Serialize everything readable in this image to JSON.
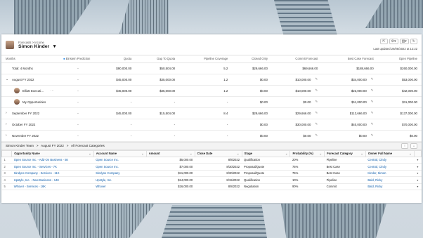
{
  "header": {
    "breadcrumb": "Forecasts  >  Income",
    "user_name": "Simon Kinder",
    "last_updated": "Last updated 26/08/2022 at 12:22",
    "tool_icons": [
      "share-icon",
      "gear-icon",
      "columns-icon",
      "refresh-icon"
    ]
  },
  "forecast": {
    "columns": [
      "Months",
      "Einstein Prediction",
      "Quota",
      "Gap To Quota",
      "Pipeline Coverage",
      "Closed Only",
      "Commit Forecast",
      "Best Case Forecast",
      "Open Pipeline"
    ],
    "rows": [
      {
        "name": "Total: 4 Months",
        "level": 0,
        "chevron": "",
        "einstein": "-",
        "quota": "$90,000.00",
        "gap": "$50,504.00",
        "coverage": "5.2",
        "closed": "$29,666.00",
        "commit": "$69,666.00",
        "best": "$188,666.00",
        "open": "$260,000.00",
        "edit": false
      },
      {
        "name": "August FY 2022",
        "level": 0,
        "chevron": "⌄",
        "einstein": "-",
        "quota": "$45,000.00",
        "gap": "$35,000.00",
        "coverage": "1.2",
        "closed": "$0.00",
        "commit": "$10,000.00",
        "best": "$34,000.00",
        "open": "$53,000.00",
        "edit": true
      },
      {
        "name": "Elliott Executi...",
        "level": 2,
        "chevron": "",
        "einstein": "-",
        "quota": "$45,000.00",
        "gap": "$35,000.00",
        "coverage": "1.2",
        "closed": "$0.00",
        "commit": "$10,000.00",
        "best": "$23,000.00",
        "open": "$42,000.00",
        "edit": true,
        "avatar": true,
        "more": "⋯"
      },
      {
        "name": "My Opportunities",
        "level": 2,
        "chevron": "",
        "einstein": "-",
        "quota": "-",
        "gap": "-",
        "coverage": "-",
        "closed": "$0.00",
        "commit": "$0.00",
        "best": "$11,000.00",
        "open": "$11,000.00",
        "edit": true,
        "avatar": true
      },
      {
        "name": "September FY 2022",
        "level": 0,
        "chevron": "›",
        "einstein": "-",
        "quota": "$45,000.00",
        "gap": "$15,504.00",
        "coverage": "8.4",
        "closed": "$29,666.00",
        "commit": "$29,666.00",
        "best": "$113,666.00",
        "open": "$137,000.00",
        "edit": true
      },
      {
        "name": "October FY 2022",
        "level": 0,
        "chevron": "›",
        "einstein": "-",
        "quota": "-",
        "gap": "-",
        "coverage": "-",
        "closed": "$0.00",
        "commit": "$30,000.00",
        "best": "$40,000.00",
        "open": "$70,000.00",
        "edit": true
      },
      {
        "name": "November FY 2022",
        "level": 0,
        "chevron": "›",
        "einstein": "-",
        "quota": "-",
        "gap": "-",
        "coverage": "-",
        "closed": "$0.00",
        "commit": "$0.00",
        "best": "$0.00",
        "open": "$0.00",
        "edit": true
      }
    ]
  },
  "opps": {
    "title": "Simon Kinder Team   >   August FY 2022   >   All Forecast Categories",
    "columns": [
      "Opportunity Name",
      "Account Name",
      "Amount",
      "Close Date",
      "Stage",
      "Probability (%)",
      "Forecast Category",
      "Owner Full Name"
    ],
    "rows": [
      {
        "num": "1",
        "name": "Open Source Inc. - Add-On Business - 5K",
        "account": "Open Source Inc.",
        "amount": "$5,000.00",
        "date": "8/8/2022",
        "stage": "Qualification",
        "prob": "20%",
        "cat": "Pipeline",
        "owner": "Central, Cindy"
      },
      {
        "num": "2",
        "name": "Open Source Inc. - Services - 7K",
        "account": "Open Source Inc.",
        "amount": "$7,000.00",
        "date": "8/30/2022",
        "stage": "Proposal/Quote",
        "prob": "75%",
        "cat": "Best Case",
        "owner": "Central, Cindy"
      },
      {
        "num": "3",
        "name": "Sindyne Company - Services - 11K",
        "account": "Sindyne Company",
        "amount": "$11,000.00",
        "date": "8/30/2022",
        "stage": "Proposal/Quote",
        "prob": "75%",
        "cat": "Best Case",
        "owner": "Kinder, Simon"
      },
      {
        "num": "4",
        "name": "Upstyle, Inc. - New Business - 14K",
        "account": "Upstyle, Inc.",
        "amount": "$14,000.00",
        "date": "8/15/2022",
        "stage": "Qualification",
        "prob": "10%",
        "cat": "Pipeline",
        "owner": "Bald, Ricky"
      },
      {
        "num": "5",
        "name": "Whover - Services - 16K",
        "account": "Whover",
        "amount": "$16,000.00",
        "date": "8/8/2022",
        "stage": "Negotiation",
        "prob": "90%",
        "cat": "Commit",
        "owner": "Bald, Ricky"
      }
    ]
  }
}
